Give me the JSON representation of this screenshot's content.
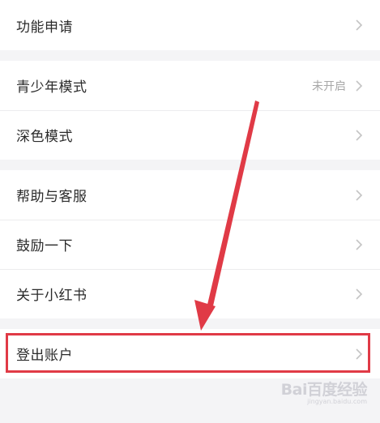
{
  "groups": [
    {
      "rows": [
        {
          "label": "功能申请",
          "value": ""
        }
      ]
    },
    {
      "rows": [
        {
          "label": "青少年模式",
          "value": "未开启"
        },
        {
          "label": "深色模式",
          "value": ""
        }
      ]
    },
    {
      "rows": [
        {
          "label": "帮助与客服",
          "value": ""
        },
        {
          "label": "鼓励一下",
          "value": ""
        },
        {
          "label": "关于小红书",
          "value": ""
        }
      ]
    },
    {
      "rows": [
        {
          "label": "登出账户",
          "value": ""
        }
      ]
    }
  ],
  "icons": {
    "row_chevron": "chevron-right-icon"
  },
  "annotation": {
    "highlight_color": "#e03a46",
    "arrow_color": "#e03a46"
  },
  "watermark": {
    "brand": "Bai百度经验",
    "url": "jingyan.baidu.com"
  }
}
